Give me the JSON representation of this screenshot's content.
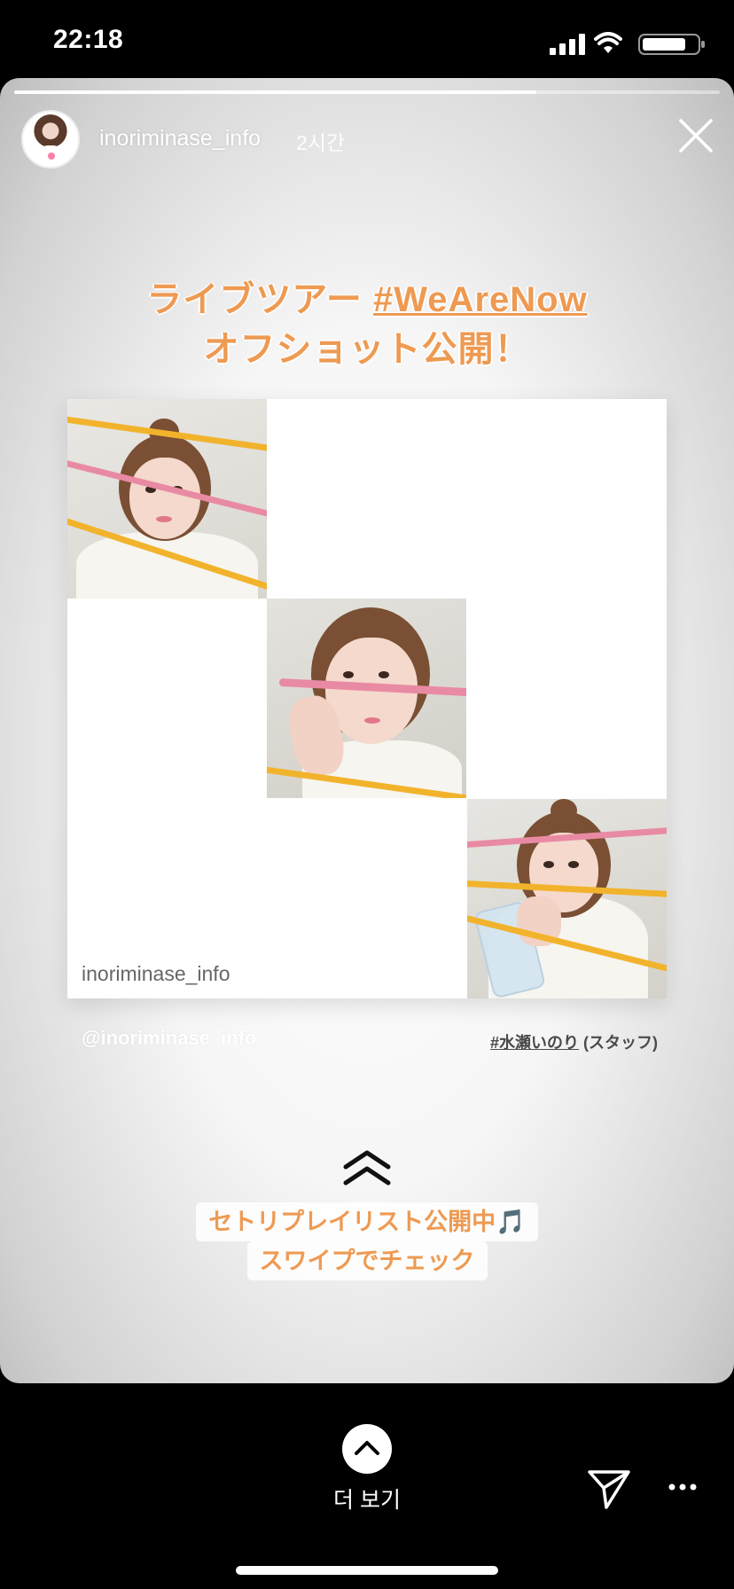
{
  "status_bar": {
    "time": "22:18"
  },
  "story": {
    "progress": 0.74,
    "username": "inoriminase_info",
    "time_ago": "2시간",
    "headline": {
      "line1_text": "ライブツアー ",
      "line1_hashtag": "#WeAreNow",
      "line2": "オフショット公開！"
    },
    "collage_watermark": "inoriminase_info",
    "mention": "@inoriminase_info",
    "hashtag_credit": {
      "tag": "#水瀬いのり",
      "suffix": " (スタッフ)"
    },
    "swipe_text": {
      "line1": "セトリプレイリスト公開中🎵",
      "line2": "スワイプでチェック"
    }
  },
  "bottom_bar": {
    "see_more_label": "더 보기"
  },
  "colors": {
    "accent_orange": "#ee9a52",
    "background": "#000000"
  },
  "icons": [
    "signal-icon",
    "wifi-icon",
    "battery-icon",
    "close-icon",
    "chevron-up-icon",
    "send-icon",
    "more-icon"
  ]
}
